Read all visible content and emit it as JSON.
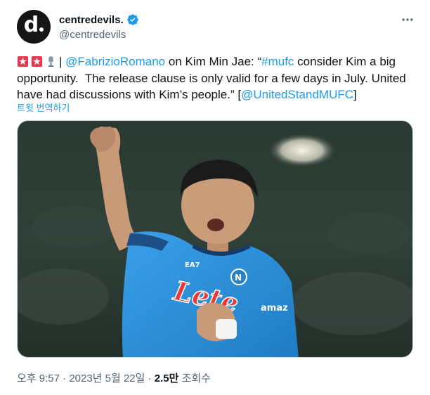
{
  "account": {
    "display_name": "centredevils.",
    "handle": "@centredevils",
    "avatar_letter": "d"
  },
  "tweet": {
    "mention_1": "@FabrizioRomano",
    "text_1": " on Kim Min Jae: “",
    "hashtag": "#mufc",
    "text_2": " consider Kim a big opportunity.  The release clause is only valid for a few days in July. United have had discussions with Kim’s people.” [",
    "mention_2": "@UnitedStandMUFC",
    "text_3": "]",
    "separator": "|"
  },
  "translate_label": "트윗 번역하기",
  "image": {
    "sponsor_text": "Lete",
    "sleeve_text": "EA7",
    "brand_text": "amaz"
  },
  "footer": {
    "time": "오후 9:57",
    "dot": "·",
    "date": "2023년 5월 22일",
    "views_count": "2.5만",
    "views_label": "조회수"
  },
  "icons": [
    "verified-badge-icon",
    "more-options-icon",
    "siren-emoji-icon",
    "microphone-emoji-icon"
  ],
  "colors": {
    "accent": "#1d9bf0",
    "secondary": "#536471",
    "text": "#0f1419",
    "jersey": "#2a8fd6"
  }
}
